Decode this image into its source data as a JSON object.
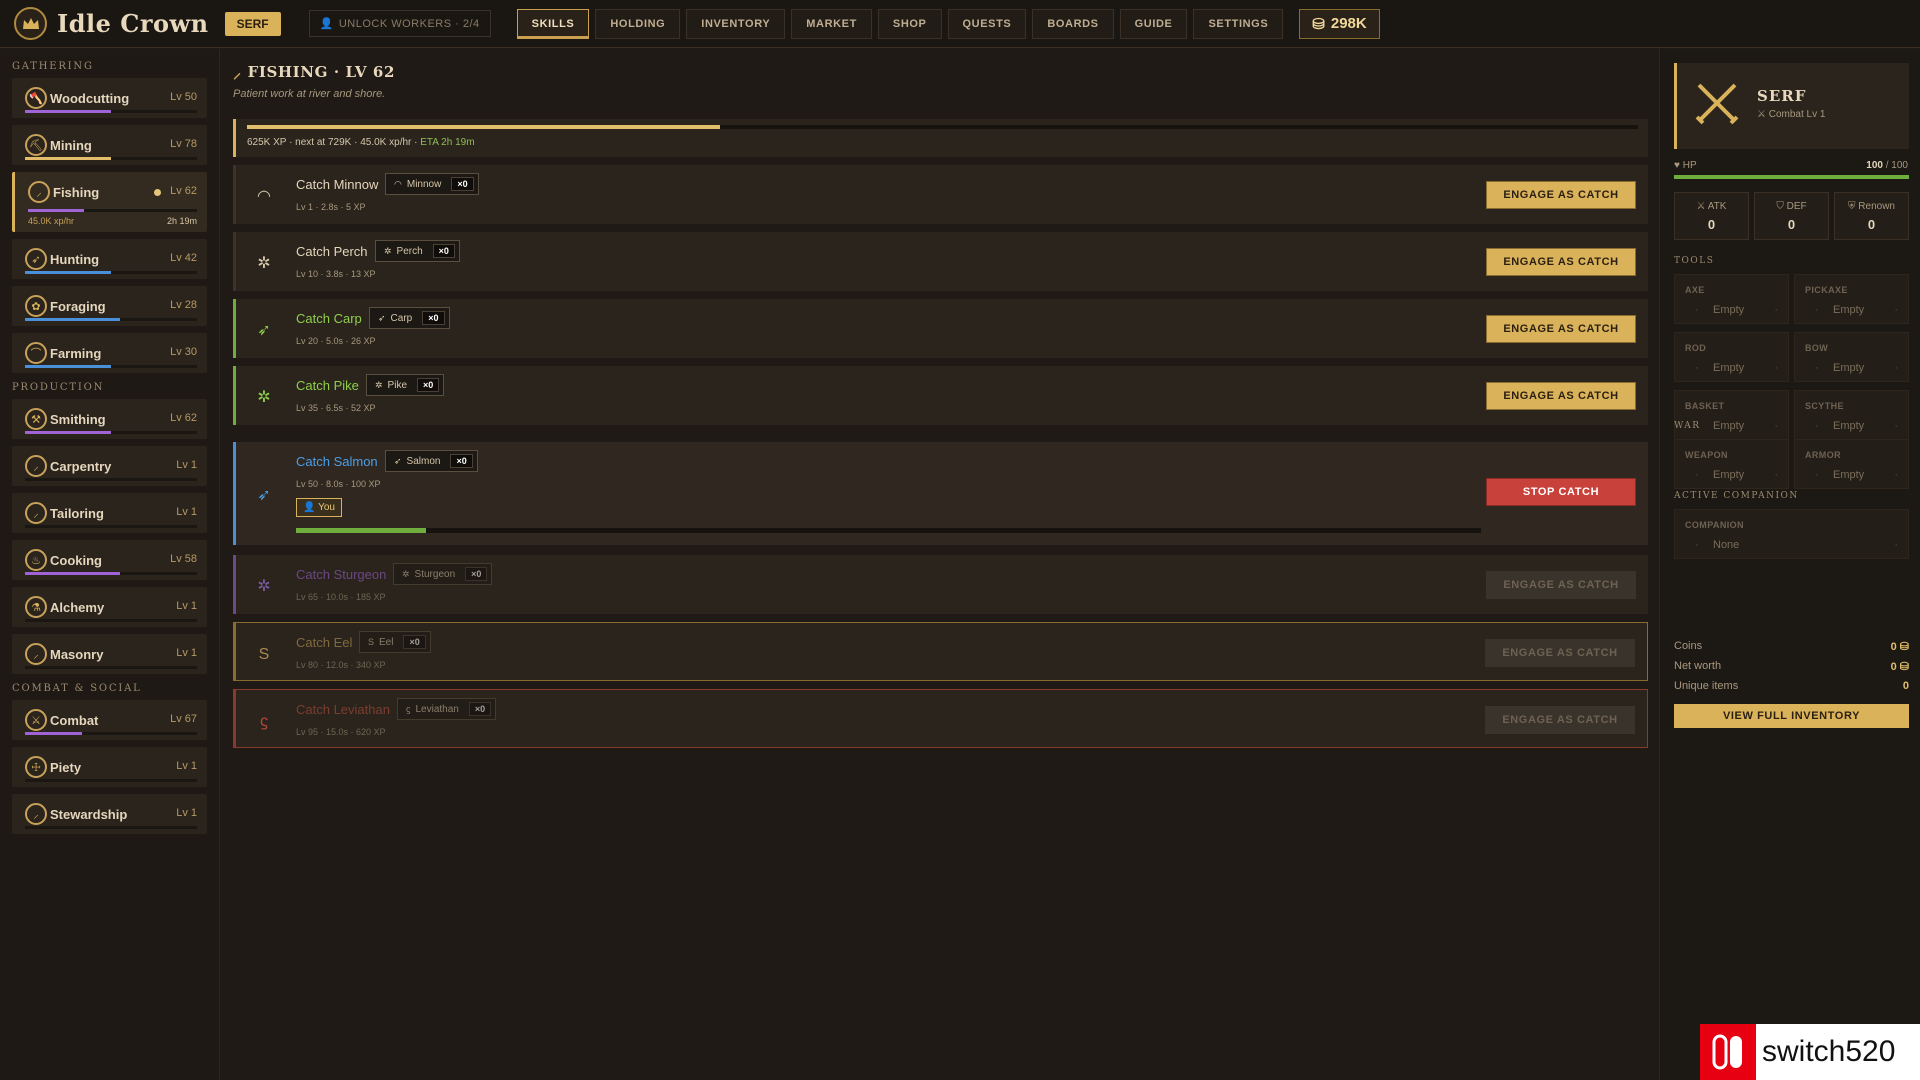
{
  "app": {
    "title": "Idle Crown",
    "rank": "SERF",
    "unlock_workers": "UNLOCK WORKERS · 2/4",
    "coins": "298K"
  },
  "nav": [
    "SKILLS",
    "HOLDING",
    "INVENTORY",
    "MARKET",
    "SHOP",
    "QUESTS",
    "BOARDS",
    "GUIDE",
    "SETTINGS"
  ],
  "nav_active": "SKILLS",
  "sidebar": {
    "gathering_label": "GATHERING",
    "production_label": "PRODUCTION",
    "combat_label": "COMBAT & SOCIAL",
    "gathering": [
      {
        "name": "Woodcutting",
        "level": "Lv 50",
        "progress": 0.5,
        "color": "#a064d6"
      },
      {
        "name": "Mining",
        "level": "Lv 78",
        "progress": 0.5,
        "color": "#e2be6c"
      },
      {
        "name": "Fishing",
        "level": "Lv 62",
        "progress": 0.33,
        "color": "#a064d6",
        "rate": "45.0K xp/hr",
        "eta": "2h 19m"
      },
      {
        "name": "Hunting",
        "level": "Lv 42",
        "progress": 0.5,
        "color": "#4a90d9"
      },
      {
        "name": "Foraging",
        "level": "Lv 28",
        "progress": 0.55,
        "color": "#4a90d9"
      },
      {
        "name": "Farming",
        "level": "Lv 30",
        "progress": 0.5,
        "color": "#4a90d9"
      }
    ],
    "production": [
      {
        "name": "Smithing",
        "level": "Lv 62",
        "progress": 0.5,
        "color": "#a064d6"
      },
      {
        "name": "Carpentry",
        "level": "Lv 1",
        "progress": 0,
        "color": "#4a90d9"
      },
      {
        "name": "Tailoring",
        "level": "Lv 1",
        "progress": 0,
        "color": "#4a90d9"
      },
      {
        "name": "Cooking",
        "level": "Lv 58",
        "progress": 0.55,
        "color": "#a064d6"
      },
      {
        "name": "Alchemy",
        "level": "Lv 1",
        "progress": 0,
        "color": "#4a90d9"
      },
      {
        "name": "Masonry",
        "level": "Lv 1",
        "progress": 0,
        "color": "#4a90d9"
      }
    ],
    "combat": [
      {
        "name": "Combat",
        "level": "Lv 67",
        "progress": 0.33,
        "color": "#a064d6"
      },
      {
        "name": "Piety",
        "level": "Lv 1",
        "progress": 0,
        "color": "#4a90d9"
      },
      {
        "name": "Stewardship",
        "level": "Lv 1",
        "progress": 0,
        "color": "#4a90d9"
      }
    ]
  },
  "main": {
    "title": "FISHING · LV 62",
    "subtitle": "Patient work at river and shore.",
    "xp_progress": 0.34,
    "xp_text": "625K XP · next at 729K · 45.0K xp/hr · ",
    "xp_eta": "ETA 2h 19m",
    "actions": [
      {
        "name": "Catch Minnow",
        "item": "Minnow",
        "count": "×0",
        "meta": "Lv 1 · 2.8s · 5 XP",
        "button": "ENGAGE AS CATCH",
        "color": "#e5d6bc",
        "border": "#3c3227",
        "icon": "◠",
        "icon_color": "#d6c6aa",
        "state": "normal"
      },
      {
        "name": "Catch Perch",
        "item": "Perch",
        "count": "×0",
        "meta": "Lv 10 · 3.8s · 13 XP",
        "button": "ENGAGE AS CATCH",
        "color": "#e5d6bc",
        "border": "#3c3227",
        "icon": "✲",
        "icon_color": "#d6c6aa",
        "state": "normal"
      },
      {
        "name": "Catch Carp",
        "item": "Carp",
        "count": "×0",
        "meta": "Lv 20 · 5.0s · 26 XP",
        "button": "ENGAGE AS CATCH",
        "color": "#8fcf4a",
        "border": "#6fae3c",
        "icon": "➶",
        "icon_color": "#8fcf4a",
        "state": "normal"
      },
      {
        "name": "Catch Pike",
        "item": "Pike",
        "count": "×0",
        "meta": "Lv 35 · 6.5s · 52 XP",
        "button": "ENGAGE AS CATCH",
        "color": "#8fcf4a",
        "border": "#6fae3c",
        "icon": "✲",
        "icon_color": "#8fcf4a",
        "state": "normal"
      },
      {
        "name": "Catch Salmon",
        "item": "Salmon",
        "count": "×0",
        "meta": "Lv 50 · 8.0s · 100 XP",
        "button": "STOP CATCH",
        "color": "#4a9ee8",
        "border": "#4a90d9",
        "icon": "➶",
        "icon_color": "#4a9ee8",
        "state": "active",
        "worker": "You",
        "progress": 0.11
      },
      {
        "name": "Catch Sturgeon",
        "item": "Sturgeon",
        "count": "×0",
        "meta": "Lv 65 · 10.0s · 185 XP",
        "button": "ENGAGE AS CATCH",
        "color": "#a064d6",
        "border": "#6a4a8a",
        "icon": "✲",
        "icon_color": "#7a5aa0",
        "state": "dim"
      },
      {
        "name": "Catch Eel",
        "item": "Eel",
        "count": "×0",
        "meta": "Lv 80 · 12.0s · 340 XP",
        "button": "ENGAGE AS CATCH",
        "color": "#c9a25a",
        "border": "#8b6c30",
        "icon": "S",
        "icon_color": "#a88a52",
        "state": "dim"
      },
      {
        "name": "Catch Leviathan",
        "item": "Leviathan",
        "count": "×0",
        "meta": "Lv 95 · 15.0s · 620 XP",
        "button": "ENGAGE AS CATCH",
        "color": "#c0503c",
        "border": "#8a3a2c",
        "icon": "ϛ",
        "icon_color": "#b04a38",
        "state": "dim"
      }
    ]
  },
  "right": {
    "hero_name": "SERF",
    "hero_sub": "⚔ Combat Lv 1",
    "hp_label": "♥ HP",
    "hp_value": "100",
    "hp_max": " / 100",
    "hp_fraction": 1,
    "stats": [
      {
        "label": "⚔ ATK",
        "value": "0"
      },
      {
        "label": "⛉ DEF",
        "value": "0"
      },
      {
        "label": "⛨ Renown",
        "value": "0"
      }
    ],
    "tools_label": "TOOLS",
    "tools": [
      {
        "type": "AXE",
        "value": "Empty"
      },
      {
        "type": "PICKAXE",
        "value": "Empty"
      },
      {
        "type": "ROD",
        "value": "Empty"
      },
      {
        "type": "BOW",
        "value": "Empty"
      },
      {
        "type": "BASKET",
        "value": "Empty"
      },
      {
        "type": "SCYTHE",
        "value": "Empty"
      }
    ],
    "war_label": "WAR",
    "war": [
      {
        "type": "WEAPON",
        "value": "Empty"
      },
      {
        "type": "ARMOR",
        "value": "Empty"
      }
    ],
    "companion_label": "ACTIVE COMPANION",
    "companion": {
      "type": "COMPANION",
      "value": "None"
    },
    "coins_label": "Coins",
    "coins_value": "0",
    "networth_label": "Net worth",
    "networth_value": "0",
    "unique_label": "Unique items",
    "unique_value": "0",
    "inventory_button": "VIEW FULL INVENTORY"
  },
  "watermark": "switch520"
}
